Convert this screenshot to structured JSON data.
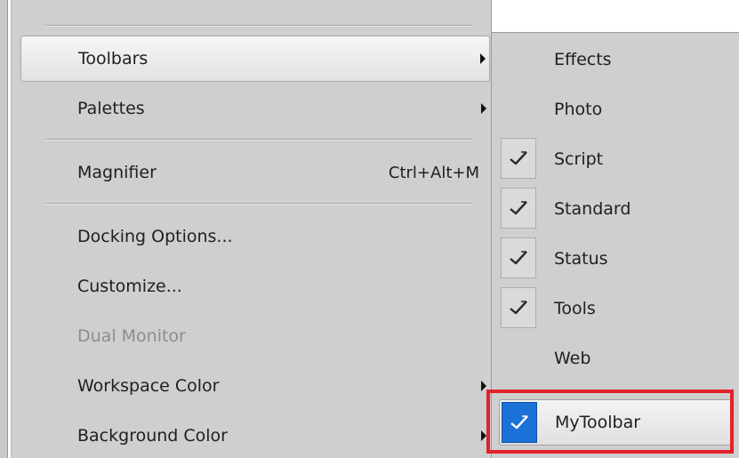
{
  "main_menu": {
    "items": [
      {
        "label": "Toolbars",
        "shortcut": "",
        "has_submenu": true,
        "state": "highlighted"
      },
      {
        "label": "Palettes",
        "shortcut": "",
        "has_submenu": true,
        "state": "normal"
      },
      {
        "label": "Magnifier",
        "shortcut": "Ctrl+Alt+M",
        "has_submenu": false,
        "state": "normal"
      },
      {
        "label": "Docking Options...",
        "shortcut": "",
        "has_submenu": false,
        "state": "normal"
      },
      {
        "label": "Customize...",
        "shortcut": "",
        "has_submenu": false,
        "state": "normal"
      },
      {
        "label": "Dual Monitor",
        "shortcut": "",
        "has_submenu": false,
        "state": "disabled"
      },
      {
        "label": "Workspace Color",
        "shortcut": "",
        "has_submenu": true,
        "state": "normal"
      },
      {
        "label": "Background Color",
        "shortcut": "",
        "has_submenu": true,
        "state": "normal"
      }
    ]
  },
  "toolbars_submenu": {
    "items": [
      {
        "label": "Effects",
        "checked": false
      },
      {
        "label": "Photo",
        "checked": false
      },
      {
        "label": "Script",
        "checked": true
      },
      {
        "label": "Standard",
        "checked": true
      },
      {
        "label": "Status",
        "checked": true
      },
      {
        "label": "Tools",
        "checked": true
      },
      {
        "label": "Web",
        "checked": false
      },
      {
        "label": "MyToolbar",
        "checked": true,
        "selected": true
      }
    ]
  },
  "colors": {
    "menu_bg": "#cfcfcf",
    "highlight_annotation": "#e3212b",
    "selected_check_bg": "#1a72d8"
  }
}
